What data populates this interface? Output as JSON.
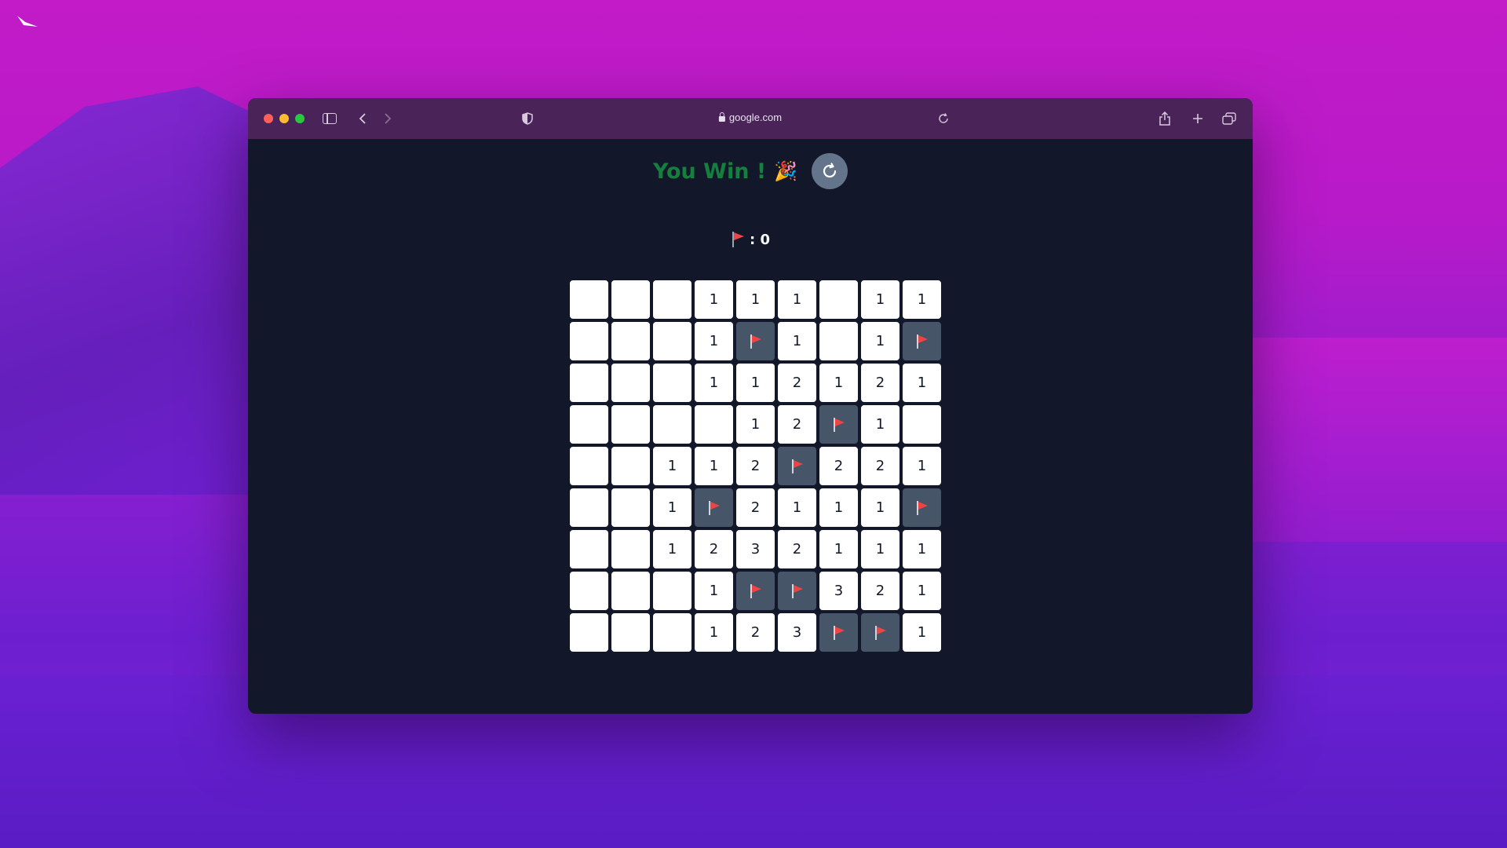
{
  "browser": {
    "url": "google.com",
    "icons": {
      "sidebar": "sidebar-icon",
      "back": "chevron-left-icon",
      "forward": "chevron-right-icon",
      "privacy": "shield-icon",
      "reload": "reload-icon",
      "share": "share-icon",
      "new_tab": "plus-icon",
      "tabs": "tabs-icon"
    }
  },
  "game": {
    "status": "You Win !",
    "status_emoji": "🎉",
    "flag_label": ": 0",
    "colors": {
      "win_text": "#15803d",
      "flag": "#ef4444",
      "revealed_cell": "#ffffff",
      "flagged_cell": "#475569",
      "board_bg": "#121829"
    },
    "board": [
      [
        "",
        "",
        "",
        "1",
        "1",
        "1",
        "",
        "1",
        "1"
      ],
      [
        "",
        "",
        "",
        "1",
        "F",
        "1",
        "",
        "1",
        "F"
      ],
      [
        "",
        "",
        "",
        "1",
        "1",
        "2",
        "1",
        "2",
        "1"
      ],
      [
        "",
        "",
        "",
        "",
        "1",
        "2",
        "F",
        "1",
        ""
      ],
      [
        "",
        "",
        "1",
        "1",
        "2",
        "F",
        "2",
        "2",
        "1"
      ],
      [
        "",
        "",
        "1",
        "F",
        "2",
        "1",
        "1",
        "1",
        "F"
      ],
      [
        "",
        "",
        "1",
        "2",
        "3",
        "2",
        "1",
        "1",
        "1"
      ],
      [
        "",
        "",
        "",
        "1",
        "F",
        "F",
        "3",
        "2",
        "1"
      ],
      [
        "",
        "",
        "",
        "1",
        "2",
        "3",
        "F",
        "F",
        "1"
      ]
    ]
  }
}
